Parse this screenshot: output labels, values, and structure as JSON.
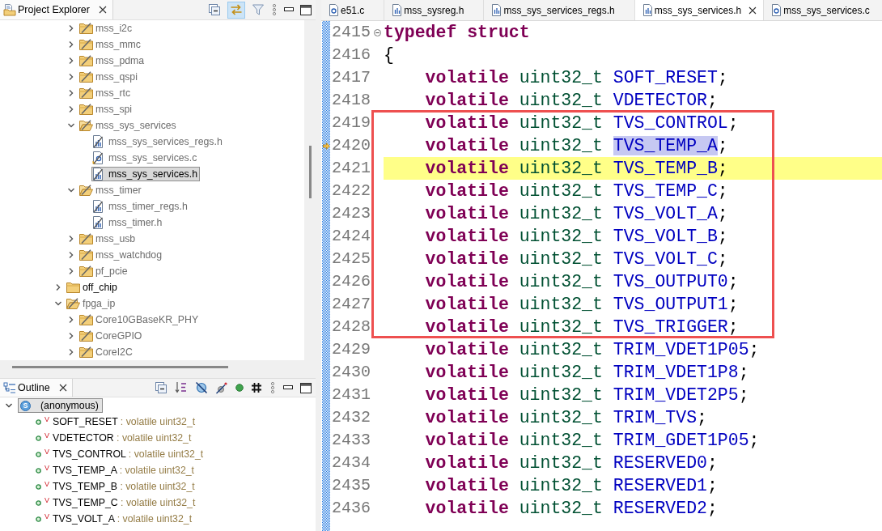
{
  "project_explorer": {
    "title": "Project Explorer",
    "linked": true,
    "tree": {
      "scrolled_parent_children": [
        {
          "label": "mss_i2c",
          "kind": "folder",
          "expanded": false,
          "excluded": true,
          "selected": false
        },
        {
          "label": "mss_mmc",
          "kind": "folder",
          "expanded": false,
          "excluded": true,
          "selected": false
        },
        {
          "label": "mss_pdma",
          "kind": "folder",
          "expanded": false,
          "excluded": true,
          "selected": false
        },
        {
          "label": "mss_qspi",
          "kind": "folder",
          "expanded": false,
          "excluded": true,
          "selected": false
        },
        {
          "label": "mss_rtc",
          "kind": "folder",
          "expanded": false,
          "excluded": true,
          "selected": false
        },
        {
          "label": "mss_spi",
          "kind": "folder",
          "expanded": false,
          "excluded": true,
          "selected": false
        },
        {
          "label": "mss_sys_services",
          "kind": "folder",
          "expanded": true,
          "excluded": true,
          "selected": false,
          "children": [
            {
              "label": "mss_sys_services_regs.h",
              "kind": "header",
              "excluded": true,
              "selected": false
            },
            {
              "label": "mss_sys_services.c",
              "kind": "source",
              "excluded": true,
              "selected": false
            },
            {
              "label": "mss_sys_services.h",
              "kind": "header",
              "excluded": true,
              "selected": true
            }
          ]
        },
        {
          "label": "mss_timer",
          "kind": "folder",
          "expanded": true,
          "excluded": true,
          "selected": false,
          "children": [
            {
              "label": "mss_timer_regs.h",
              "kind": "header",
              "excluded": true,
              "selected": false
            },
            {
              "label": "mss_timer.h",
              "kind": "header",
              "excluded": true,
              "selected": false
            }
          ]
        },
        {
          "label": "mss_usb",
          "kind": "folder",
          "expanded": false,
          "excluded": true,
          "selected": false
        },
        {
          "label": "mss_watchdog",
          "kind": "folder",
          "expanded": false,
          "excluded": true,
          "selected": false
        },
        {
          "label": "pf_pcie",
          "kind": "folder",
          "expanded": false,
          "excluded": true,
          "selected": false
        }
      ],
      "items": [
        {
          "label": "off_chip",
          "kind": "folder",
          "expanded": false,
          "excluded": false,
          "selected": false
        },
        {
          "label": "fpga_ip",
          "kind": "folder",
          "expanded": true,
          "excluded": true,
          "selected": false,
          "children": [
            {
              "label": "Core10GBaseKR_PHY",
              "kind": "folder",
              "expanded": false,
              "excluded": true,
              "selected": false
            },
            {
              "label": "CoreGPIO",
              "kind": "folder",
              "expanded": false,
              "excluded": true,
              "selected": false
            },
            {
              "label": "CoreI2C",
              "kind": "folder",
              "expanded": false,
              "excluded": true,
              "selected": false
            }
          ]
        }
      ]
    }
  },
  "outline": {
    "title": "Outline",
    "items": [
      {
        "badge": "S",
        "label": "(anonymous)",
        "expanded": true,
        "selected": true,
        "children": [
          {
            "mark": "V",
            "label": "SOFT_RESET",
            "type": ": volatile uint32_t",
            "selected": false
          },
          {
            "mark": "V",
            "label": "VDETECTOR",
            "type": ": volatile uint32_t",
            "selected": false
          },
          {
            "mark": "V",
            "label": "TVS_CONTROL",
            "type": ": volatile uint32_t",
            "selected": false
          },
          {
            "mark": "V",
            "label": "TVS_TEMP_A",
            "type": ": volatile uint32_t",
            "selected": false
          },
          {
            "mark": "V",
            "label": "TVS_TEMP_B",
            "type": ": volatile uint32_t",
            "selected": false
          },
          {
            "mark": "V",
            "label": "TVS_TEMP_C",
            "type": ": volatile uint32_t",
            "selected": false
          },
          {
            "mark": "V",
            "label": "TVS_VOLT_A",
            "type": ": volatile uint32_t",
            "selected": false
          }
        ]
      }
    ]
  },
  "editor": {
    "tabs": [
      {
        "label": "e51.c",
        "kind": "source",
        "selected": false
      },
      {
        "label": "mss_sysreg.h",
        "kind": "header",
        "selected": false
      },
      {
        "label": "mss_sys_services_regs.h",
        "kind": "header",
        "selected": false
      },
      {
        "label": "mss_sys_services.h",
        "kind": "header",
        "selected": true
      },
      {
        "label": "mss_sys_services.c",
        "kind": "source",
        "selected": false
      }
    ],
    "blocks": [
      {
        "boxed": false,
        "lines": [
          {
            "number": "2415",
            "indented": false,
            "fold": true,
            "pointer": false,
            "current": false,
            "tokens": [
              {
                "text": "typedef",
                "kind": "keyword"
              },
              {
                "text": "struct",
                "kind": "keyword"
              }
            ]
          },
          {
            "number": "2416",
            "indented": false,
            "fold": false,
            "pointer": false,
            "current": false,
            "tokens": [
              {
                "text": "{",
                "kind": "punct"
              }
            ]
          },
          {
            "number": "2417",
            "indented": true,
            "fold": false,
            "pointer": false,
            "current": false,
            "tokens": [
              {
                "text": "volatile",
                "kind": "keyword"
              },
              {
                "text": "uint32_t",
                "kind": "type"
              },
              {
                "text": "SOFT_RESET",
                "kind": "field",
                "selected": false
              },
              {
                "text": ";",
                "kind": "punct"
              }
            ]
          },
          {
            "number": "2418",
            "indented": true,
            "fold": false,
            "pointer": false,
            "current": false,
            "tokens": [
              {
                "text": "volatile",
                "kind": "keyword"
              },
              {
                "text": "uint32_t",
                "kind": "type"
              },
              {
                "text": "VDETECTOR",
                "kind": "field",
                "selected": false
              },
              {
                "text": ";",
                "kind": "punct"
              }
            ]
          }
        ]
      },
      {
        "boxed": true,
        "lines": [
          {
            "number": "2419",
            "indented": true,
            "fold": false,
            "pointer": false,
            "current": false,
            "tokens": [
              {
                "text": "volatile",
                "kind": "keyword"
              },
              {
                "text": "uint32_t",
                "kind": "type"
              },
              {
                "text": "TVS_CONTROL",
                "kind": "field",
                "selected": false
              },
              {
                "text": ";",
                "kind": "punct"
              }
            ]
          },
          {
            "number": "2420",
            "indented": true,
            "fold": false,
            "pointer": true,
            "current": false,
            "tokens": [
              {
                "text": "volatile",
                "kind": "keyword"
              },
              {
                "text": "uint32_t",
                "kind": "type"
              },
              {
                "text": "TVS_TEMP_A",
                "kind": "field",
                "selected": true
              },
              {
                "text": ";",
                "kind": "punct"
              }
            ]
          },
          {
            "number": "2421",
            "indented": true,
            "fold": false,
            "pointer": false,
            "current": true,
            "tokens": [
              {
                "text": "volatile",
                "kind": "keyword"
              },
              {
                "text": "uint32_t",
                "kind": "type"
              },
              {
                "text": "TVS_TEMP_B",
                "kind": "field",
                "selected": false
              },
              {
                "text": ";",
                "kind": "punct"
              }
            ]
          },
          {
            "number": "2422",
            "indented": true,
            "fold": false,
            "pointer": false,
            "current": false,
            "tokens": [
              {
                "text": "volatile",
                "kind": "keyword"
              },
              {
                "text": "uint32_t",
                "kind": "type"
              },
              {
                "text": "TVS_TEMP_C",
                "kind": "field",
                "selected": false
              },
              {
                "text": ";",
                "kind": "punct"
              }
            ]
          },
          {
            "number": "2423",
            "indented": true,
            "fold": false,
            "pointer": false,
            "current": false,
            "tokens": [
              {
                "text": "volatile",
                "kind": "keyword"
              },
              {
                "text": "uint32_t",
                "kind": "type"
              },
              {
                "text": "TVS_VOLT_A",
                "kind": "field",
                "selected": false
              },
              {
                "text": ";",
                "kind": "punct"
              }
            ]
          },
          {
            "number": "2424",
            "indented": true,
            "fold": false,
            "pointer": false,
            "current": false,
            "tokens": [
              {
                "text": "volatile",
                "kind": "keyword"
              },
              {
                "text": "uint32_t",
                "kind": "type"
              },
              {
                "text": "TVS_VOLT_B",
                "kind": "field",
                "selected": false
              },
              {
                "text": ";",
                "kind": "punct"
              }
            ]
          },
          {
            "number": "2425",
            "indented": true,
            "fold": false,
            "pointer": false,
            "current": false,
            "tokens": [
              {
                "text": "volatile",
                "kind": "keyword"
              },
              {
                "text": "uint32_t",
                "kind": "type"
              },
              {
                "text": "TVS_VOLT_C",
                "kind": "field",
                "selected": false
              },
              {
                "text": ";",
                "kind": "punct"
              }
            ]
          },
          {
            "number": "2426",
            "indented": true,
            "fold": false,
            "pointer": false,
            "current": false,
            "tokens": [
              {
                "text": "volatile",
                "kind": "keyword"
              },
              {
                "text": "uint32_t",
                "kind": "type"
              },
              {
                "text": "TVS_OUTPUT0",
                "kind": "field",
                "selected": false
              },
              {
                "text": ";",
                "kind": "punct"
              }
            ]
          },
          {
            "number": "2427",
            "indented": true,
            "fold": false,
            "pointer": false,
            "current": false,
            "tokens": [
              {
                "text": "volatile",
                "kind": "keyword"
              },
              {
                "text": "uint32_t",
                "kind": "type"
              },
              {
                "text": "TVS_OUTPUT1",
                "kind": "field",
                "selected": false
              },
              {
                "text": ";",
                "kind": "punct"
              }
            ]
          },
          {
            "number": "2428",
            "indented": true,
            "fold": false,
            "pointer": false,
            "current": false,
            "tokens": [
              {
                "text": "volatile",
                "kind": "keyword"
              },
              {
                "text": "uint32_t",
                "kind": "type"
              },
              {
                "text": "TVS_TRIGGER",
                "kind": "field",
                "selected": false
              },
              {
                "text": ";",
                "kind": "punct"
              }
            ]
          }
        ]
      },
      {
        "boxed": false,
        "lines": [
          {
            "number": "2429",
            "indented": true,
            "fold": false,
            "pointer": false,
            "current": false,
            "tokens": [
              {
                "text": "volatile",
                "kind": "keyword"
              },
              {
                "text": "uint32_t",
                "kind": "type"
              },
              {
                "text": "TRIM_VDET1P05",
                "kind": "field",
                "selected": false
              },
              {
                "text": ";",
                "kind": "punct"
              }
            ]
          },
          {
            "number": "2430",
            "indented": true,
            "fold": false,
            "pointer": false,
            "current": false,
            "tokens": [
              {
                "text": "volatile",
                "kind": "keyword"
              },
              {
                "text": "uint32_t",
                "kind": "type"
              },
              {
                "text": "TRIM_VDET1P8",
                "kind": "field",
                "selected": false
              },
              {
                "text": ";",
                "kind": "punct"
              }
            ]
          },
          {
            "number": "2431",
            "indented": true,
            "fold": false,
            "pointer": false,
            "current": false,
            "tokens": [
              {
                "text": "volatile",
                "kind": "keyword"
              },
              {
                "text": "uint32_t",
                "kind": "type"
              },
              {
                "text": "TRIM_VDET2P5",
                "kind": "field",
                "selected": false
              },
              {
                "text": ";",
                "kind": "punct"
              }
            ]
          },
          {
            "number": "2432",
            "indented": true,
            "fold": false,
            "pointer": false,
            "current": false,
            "tokens": [
              {
                "text": "volatile",
                "kind": "keyword"
              },
              {
                "text": "uint32_t",
                "kind": "type"
              },
              {
                "text": "TRIM_TVS",
                "kind": "field",
                "selected": false
              },
              {
                "text": ";",
                "kind": "punct"
              }
            ]
          },
          {
            "number": "2433",
            "indented": true,
            "fold": false,
            "pointer": false,
            "current": false,
            "tokens": [
              {
                "text": "volatile",
                "kind": "keyword"
              },
              {
                "text": "uint32_t",
                "kind": "type"
              },
              {
                "text": "TRIM_GDET1P05",
                "kind": "field",
                "selected": false
              },
              {
                "text": ";",
                "kind": "punct"
              }
            ]
          },
          {
            "number": "2434",
            "indented": true,
            "fold": false,
            "pointer": false,
            "current": false,
            "tokens": [
              {
                "text": "volatile",
                "kind": "keyword"
              },
              {
                "text": "uint32_t",
                "kind": "type"
              },
              {
                "text": "RESERVED0",
                "kind": "field",
                "selected": false
              },
              {
                "text": ";",
                "kind": "punct"
              }
            ]
          },
          {
            "number": "2435",
            "indented": true,
            "fold": false,
            "pointer": false,
            "current": false,
            "tokens": [
              {
                "text": "volatile",
                "kind": "keyword"
              },
              {
                "text": "uint32_t",
                "kind": "type"
              },
              {
                "text": "RESERVED1",
                "kind": "field",
                "selected": false
              },
              {
                "text": ";",
                "kind": "punct"
              }
            ]
          },
          {
            "number": "2436",
            "indented": true,
            "fold": false,
            "pointer": false,
            "current": false,
            "tokens": [
              {
                "text": "volatile",
                "kind": "keyword"
              },
              {
                "text": "uint32_t",
                "kind": "type"
              },
              {
                "text": "RESERVED2",
                "kind": "field",
                "selected": false
              },
              {
                "text": ";",
                "kind": "punct"
              }
            ]
          }
        ]
      }
    ]
  }
}
